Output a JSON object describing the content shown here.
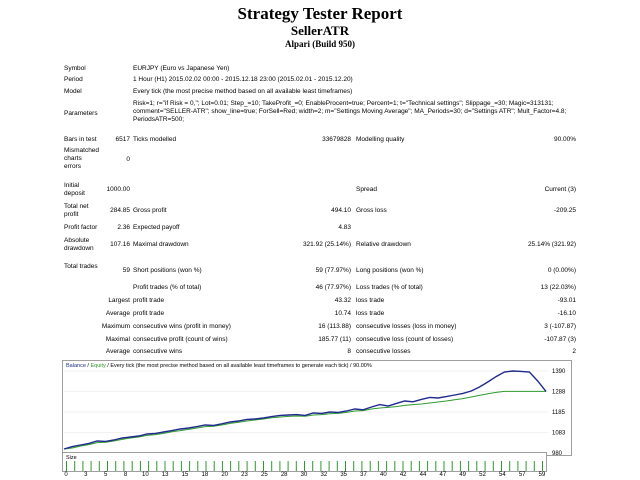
{
  "header": {
    "title": "Strategy Tester Report",
    "expert": "SellerATR",
    "broker": "Alpari (Build 950)"
  },
  "info": {
    "symbol_label": "Symbol",
    "symbol_value": "EURJPY (Euro vs Japanese Yen)",
    "period_label": "Period",
    "period_value": "1 Hour (H1) 2015.02.02 00:00 - 2015.12.18 23:00 (2015.02.01 - 2015.12.20)",
    "model_label": "Model",
    "model_value": "Every tick (the most precise method based on all available least timeframes)",
    "params_label": "Parameters",
    "params_value": "Risk=1; r=\"if Risk = 0,\"; Lot=0.01; Step_=10; TakeProfit_=0; EnableProcent=true; Percent=1; t=\"Technical settings\"; Slippage_=30; Magic=313131; comment=\"SELLER-ATR\"; show_line=true; ForSell=Red; width=2; m=\"Settings Moving Average\"; MA_Periods=30; d=\"Settings ATR\"; Mult_Factor=4.8; PeriodsATR=500;"
  },
  "stats": {
    "bars_label": "Bars in test",
    "bars_value": "6517",
    "ticks_label": "Ticks modelled",
    "ticks_value": "33679828",
    "quality_label": "Modelling quality",
    "quality_value": "90.00%",
    "mismatch_label": "Mismatched charts errors",
    "mismatch_value": "0",
    "deposit_label": "Initial deposit",
    "deposit_value": "1000.00",
    "spread_label": "Spread",
    "spread_value": "Current (3)",
    "netprofit_label": "Total net profit",
    "netprofit_value": "284.85",
    "grossprofit_label": "Gross profit",
    "grossprofit_value": "494.10",
    "grossloss_label": "Gross loss",
    "grossloss_value": "-209.25",
    "pf_label": "Profit factor",
    "pf_value": "2.36",
    "payoff_label": "Expected payoff",
    "payoff_value": "4.83",
    "absdd_label": "Absolute drawdown",
    "absdd_value": "107.16",
    "maxdd_label": "Maximal drawdown",
    "maxdd_value": "321.92 (25.14%)",
    "reldd_label": "Relative drawdown",
    "reldd_value": "25.14% (321.92)",
    "trades_label": "Total trades",
    "trades_value": "59",
    "short_label": "Short positions (won %)",
    "short_value": "59 (77.97%)",
    "long_label": "Long positions (won %)",
    "long_value": "0 (0.00%)",
    "ptrades_label": "Profit trades (% of total)",
    "ptrades_value": "46 (77.97%)",
    "ltrades_label": "Loss trades (% of total)",
    "ltrades_value": "13 (22.03%)",
    "largest_label": "Largest",
    "largest_profit_label": "profit trade",
    "largest_profit_value": "43.32",
    "largest_loss_label": "loss trade",
    "largest_loss_value": "-93.01",
    "average_label": "Average",
    "average_profit_label": "profit trade",
    "average_profit_value": "10.74",
    "average_loss_label": "loss trade",
    "average_loss_value": "-16.10",
    "maximum_label": "Maximum",
    "max_wins_label": "consecutive wins (profit in money)",
    "max_wins_value": "16 (113.88)",
    "max_losses_label": "consecutive losses (loss in money)",
    "max_losses_value": "3 (-107.87)",
    "maximal_label": "Maximal",
    "mx_profit_label": "consecutive profit (count of wins)",
    "mx_profit_value": "185.77 (11)",
    "mx_loss_label": "consecutive loss (count of losses)",
    "mx_loss_value": "-107.87 (3)",
    "avg2_label": "Average",
    "avg_wins_label": "consecutive wins",
    "avg_wins_value": "8",
    "avg_losses_label": "consecutive losses",
    "avg_losses_value": "2"
  },
  "chart_data": {
    "type": "line",
    "legend_balance": "Balance",
    "legend_sep": " / ",
    "legend_equity": "Equity",
    "legend_rest": " / Every tick (the most precise method based on all available least timeframes to generate each tick) / 90.00%",
    "size_label": "Size",
    "ylim": [
      980,
      1400
    ],
    "yticks": [
      "1390",
      "1288",
      "1185",
      "1083",
      "980"
    ],
    "xticks": [
      "0",
      "3",
      "5",
      "8",
      "10",
      "13",
      "15",
      "18",
      "20",
      "23",
      "25",
      "28",
      "30",
      "32",
      "35",
      "37",
      "40",
      "42",
      "44",
      "47",
      "49",
      "52",
      "54",
      "57",
      "59"
    ],
    "balance_color": "#1f2a8c",
    "equity_color": "#2e9b2e",
    "balance": [
      1000,
      1012,
      1020,
      1028,
      1040,
      1038,
      1045,
      1055,
      1060,
      1065,
      1075,
      1078,
      1085,
      1092,
      1100,
      1105,
      1112,
      1120,
      1118,
      1126,
      1135,
      1140,
      1148,
      1150,
      1155,
      1162,
      1168,
      1170,
      1172,
      1168,
      1180,
      1178,
      1185,
      1183,
      1190,
      1200,
      1196,
      1210,
      1222,
      1215,
      1228,
      1240,
      1236,
      1248,
      1258,
      1255,
      1262,
      1270,
      1278,
      1290,
      1310,
      1335,
      1362,
      1385,
      1390,
      1388,
      1385,
      1340,
      1288
    ],
    "equity": [
      1000,
      1005,
      1015,
      1022,
      1032,
      1034,
      1040,
      1048,
      1055,
      1060,
      1068,
      1072,
      1078,
      1086,
      1092,
      1098,
      1105,
      1112,
      1114,
      1120,
      1128,
      1134,
      1140,
      1145,
      1150,
      1156,
      1160,
      1163,
      1165,
      1164,
      1170,
      1172,
      1176,
      1178,
      1183,
      1190,
      1192,
      1200,
      1205,
      1208,
      1212,
      1218,
      1222,
      1225,
      1230,
      1235,
      1240,
      1246,
      1252,
      1260,
      1268,
      1276,
      1283,
      1288,
      1288,
      1288,
      1288,
      1288,
      1288
    ]
  }
}
